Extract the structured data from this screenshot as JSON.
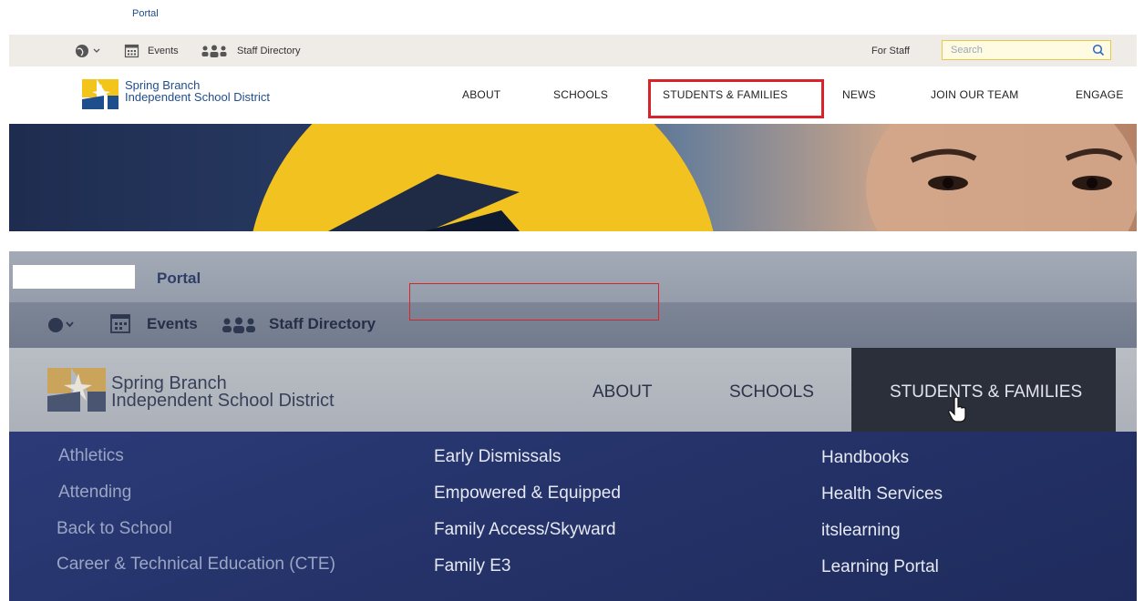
{
  "top_screenshot": {
    "portal_label": "Portal",
    "utility": {
      "events_label": "Events",
      "staff_directory_label": "Staff Directory",
      "for_staff_label": "For Staff",
      "search_placeholder": "Search"
    },
    "logo": {
      "line1": "Spring Branch",
      "line2": "Independent School District"
    },
    "nav": [
      "ABOUT",
      "SCHOOLS",
      "STUDENTS & FAMILIES",
      "NEWS",
      "JOIN OUR TEAM",
      "ENGAGE"
    ],
    "highlighted_nav": "STUDENTS & FAMILIES"
  },
  "bottom_photo": {
    "portal_label": "Portal",
    "utility": {
      "events_label": "Events",
      "staff_directory_label": "Staff Directory"
    },
    "logo": {
      "line1": "Spring Branch",
      "line2": "Independent School District"
    },
    "nav": [
      "ABOUT",
      "SCHOOLS",
      "STUDENTS & FAMILIES"
    ],
    "menu": {
      "col1": [
        "Athletics",
        "Attending",
        "Back to School",
        "Career & Technical Education (CTE)"
      ],
      "col2": [
        "Early Dismissals",
        "Empowered & Equipped",
        "Family Access/Skyward",
        "Family E3"
      ],
      "col3": [
        "Handbooks",
        "Health Services",
        "itslearning",
        "Learning Portal"
      ]
    },
    "highlighted_link": "Family Access/Skyward"
  },
  "colors": {
    "highlight": "#d8232a",
    "brand_blue": "#1f4e8c",
    "brand_yellow": "#f3c51b"
  }
}
